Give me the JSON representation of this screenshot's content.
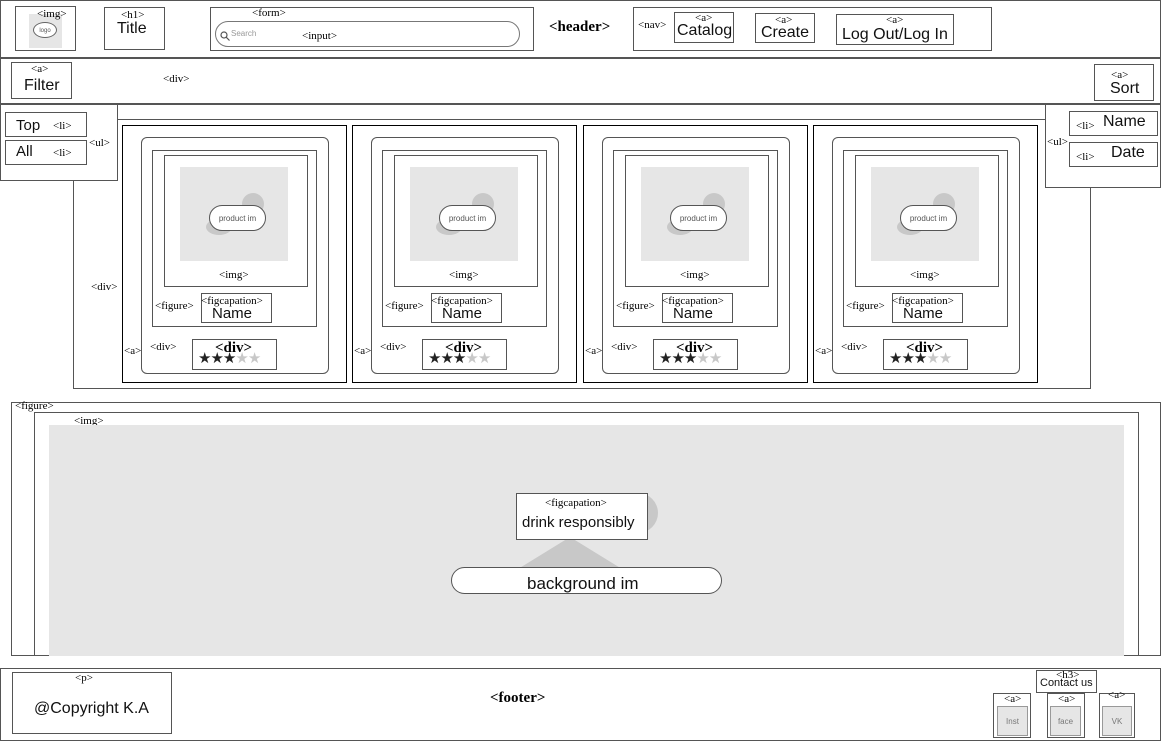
{
  "header": {
    "tag": "<header>",
    "logo_tag": "<img>",
    "logo_text": "logo",
    "title_tag": "<h1>",
    "title": "Title",
    "form_tag": "<form>",
    "search_placeholder": "Search",
    "input_tag": "<input>",
    "nav_tag": "<nav>",
    "nav_items": [
      {
        "tag": "<a>",
        "label": "Catalog"
      },
      {
        "tag": "<a>",
        "label": "Create"
      },
      {
        "tag": "<a>",
        "label": "Log Out/Log In"
      }
    ]
  },
  "toolbar": {
    "filter_tag": "<a>",
    "filter_label": "Filter",
    "div_tag": "<div>",
    "sort_tag": "<a>",
    "sort_label": "Sort"
  },
  "filter_menu": {
    "ul_tag": "<ul>",
    "li_tag": "<li>",
    "items": [
      "Top",
      "All"
    ]
  },
  "sort_menu": {
    "ul_tag": "<ul>",
    "li_tag": "<li>",
    "items": [
      "Name",
      "Date"
    ]
  },
  "catalog": {
    "div_tag": "<div>",
    "cards": [
      {
        "a_tag": "<a>",
        "div_tag": "<div>",
        "figure_tag": "<figure>",
        "img_tag": "<img>",
        "img_label": "product im",
        "caption_tag": "<figcapation>",
        "name": "Name",
        "rating_tag": "<div>",
        "rating": 3,
        "rating_max": 5
      },
      {
        "a_tag": "<a>",
        "div_tag": "<div>",
        "figure_tag": "<figure>",
        "img_tag": "<img>",
        "img_label": "product im",
        "caption_tag": "<figcapation>",
        "name": "Name",
        "rating_tag": "<div>",
        "rating": 3,
        "rating_max": 5
      },
      {
        "a_tag": "<a>",
        "div_tag": "<div>",
        "figure_tag": "<figure>",
        "img_tag": "<img>",
        "img_label": "product im",
        "caption_tag": "<figcapation>",
        "name": "Name",
        "rating_tag": "<div>",
        "rating": 3,
        "rating_max": 5
      },
      {
        "a_tag": "<a>",
        "div_tag": "<div>",
        "figure_tag": "<figure>",
        "img_tag": "<img>",
        "img_label": "product im",
        "caption_tag": "<figcapation>",
        "name": "Name",
        "rating_tag": "<div>",
        "rating": 3,
        "rating_max": 5
      }
    ]
  },
  "banner": {
    "figure_tag": "<figure>",
    "img_tag": "<img>",
    "caption_tag": "<figcapation>",
    "caption": "drink responsibly",
    "bg_label": "background im"
  },
  "footer": {
    "tag": "<footer>",
    "p_tag": "<p>",
    "copyright": "@Copyright K.A",
    "contact_tag": "<h3>",
    "contact": "Contact us",
    "social": [
      {
        "tag": "<a>",
        "label": "Inst"
      },
      {
        "tag": "<a>",
        "label": "face"
      },
      {
        "tag": "<a>",
        "label": "VK"
      }
    ]
  },
  "colors": {
    "stroke": "#555555",
    "placeholder": "#e6e6e6",
    "star_on": "#222222",
    "star_off": "#c8c8c8"
  }
}
